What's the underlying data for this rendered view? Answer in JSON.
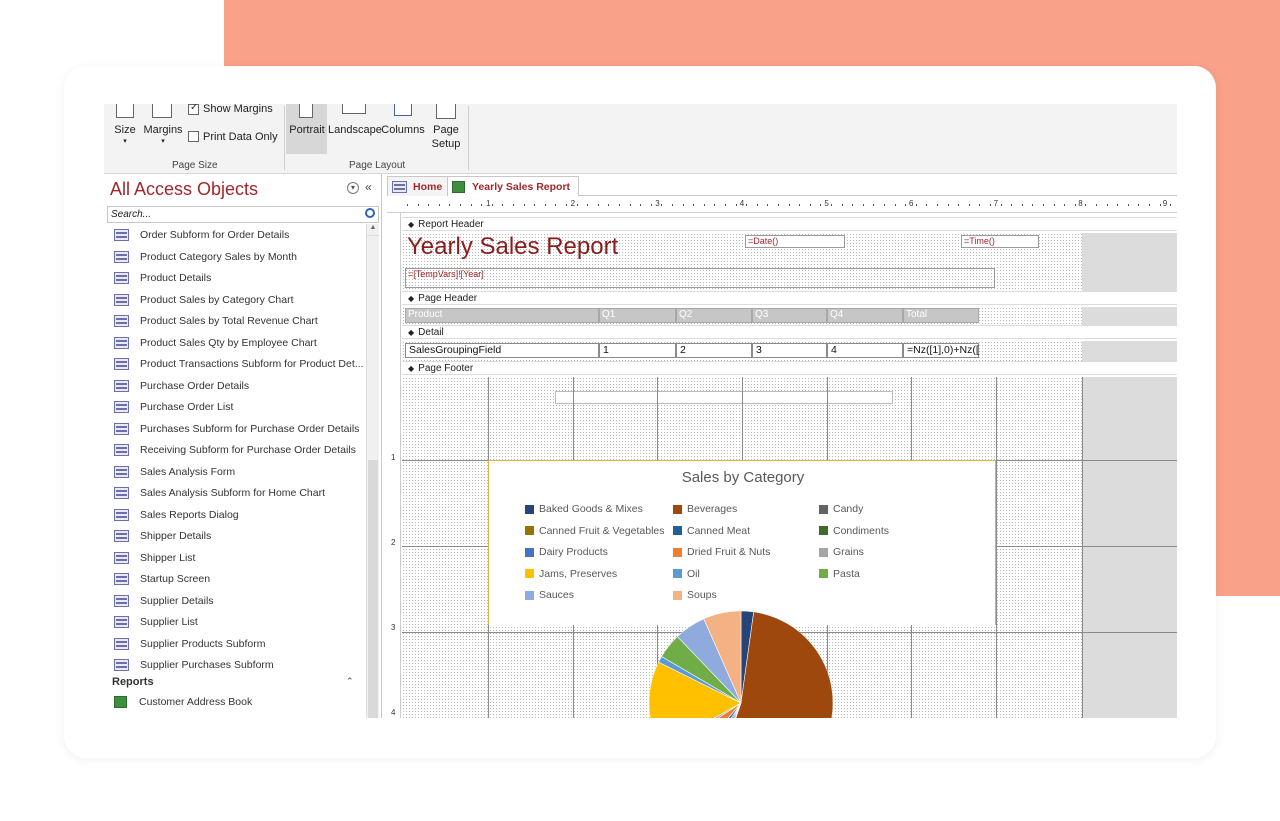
{
  "ribbon": {
    "size_label": "Size",
    "margins_label": "Margins",
    "show_margins_label": "Show Margins",
    "print_data_only_label": "Print Data Only",
    "page_size_group": "Page Size",
    "portrait_label": "Portrait",
    "landscape_label": "Landscape",
    "columns_label": "Columns",
    "page_setup_label_1": "Page",
    "page_setup_label_2": "Setup",
    "page_layout_group": "Page Layout"
  },
  "nav": {
    "title": "All Access Objects",
    "search_placeholder": "Search...",
    "items": [
      "Order Subform for Order Details",
      "Product Category Sales by Month",
      "Product Details",
      "Product Sales by Category Chart",
      "Product Sales by Total Revenue Chart",
      "Product Sales Qty by Employee Chart",
      "Product Transactions Subform for Product Det...",
      "Purchase Order Details",
      "Purchase Order List",
      "Purchases Subform for Purchase Order Details",
      "Receiving Subform for Purchase Order Details",
      "Sales Analysis Form",
      "Sales Analysis Subform for Home Chart",
      "Sales Reports Dialog",
      "Shipper Details",
      "Shipper List",
      "Startup Screen",
      "Supplier Details",
      "Supplier List",
      "Supplier Products Subform",
      "Supplier Purchases Subform"
    ],
    "reports_heading": "Reports",
    "report_items": [
      "Customer Address Book"
    ]
  },
  "tabs": {
    "home": "Home",
    "report": "Yearly Sales Report"
  },
  "ruler": [
    "1",
    "2",
    "3",
    "4",
    "5",
    "6",
    "7",
    "8",
    "9"
  ],
  "left_ruler": [
    "1",
    "2",
    "3",
    "4"
  ],
  "design": {
    "report_header": "Report Header",
    "page_header": "Page Header",
    "detail": "Detail",
    "page_footer": "Page Footer",
    "report_title": "Yearly Sales Report",
    "date_field": "=Date()",
    "time_field": "=Time()",
    "tempvars_field": "=[TempVars]![Year]",
    "header_cells": [
      "Product",
      "Q1",
      "Q2",
      "Q3",
      "Q4",
      "Total"
    ],
    "detail_cells": [
      "SalesGroupingField",
      "1",
      "2",
      "3",
      "4",
      "=Nz([1],0)+Nz(["
    ]
  },
  "chart_data": {
    "type": "pie",
    "title": "Sales by Category",
    "legend": [
      {
        "name": "Baked Goods & Mixes",
        "color": "#264478"
      },
      {
        "name": "Beverages",
        "color": "#9e480e"
      },
      {
        "name": "Candy",
        "color": "#636363"
      },
      {
        "name": "Canned Fruit & Vegetables",
        "color": "#997300"
      },
      {
        "name": "Canned Meat",
        "color": "#255e91"
      },
      {
        "name": "Condiments",
        "color": "#43682b"
      },
      {
        "name": "Dairy Products",
        "color": "#4472c4"
      },
      {
        "name": "Dried Fruit & Nuts",
        "color": "#ed7d31"
      },
      {
        "name": "Grains",
        "color": "#a5a5a5"
      },
      {
        "name": "Jams, Preserves",
        "color": "#ffc000"
      },
      {
        "name": "Oil",
        "color": "#5b9bd5"
      },
      {
        "name": "Pasta",
        "color": "#70ad47"
      },
      {
        "name": "Sauces",
        "color": "#8faadc"
      },
      {
        "name": "Soups",
        "color": "#f4b183"
      }
    ],
    "slices": [
      {
        "name": "Baked Goods & Mixes",
        "value": 2
      },
      {
        "name": "Beverages",
        "value": 48
      },
      {
        "name": "Candy",
        "value": 0.5
      },
      {
        "name": "Canned Fruit & Vegetables",
        "value": 1
      },
      {
        "name": "Canned Meat",
        "value": 1
      },
      {
        "name": "Condiments",
        "value": 1
      },
      {
        "name": "Dairy Products",
        "value": 2
      },
      {
        "name": "Dried Fruit & Nuts",
        "value": 4
      },
      {
        "name": "Grains",
        "value": 1
      },
      {
        "name": "Jams, Preserves",
        "value": 14
      },
      {
        "name": "Oil",
        "value": 1
      },
      {
        "name": "Pasta",
        "value": 4
      },
      {
        "name": "Sauces",
        "value": 5
      },
      {
        "name": "Soups",
        "value": 6
      }
    ]
  }
}
